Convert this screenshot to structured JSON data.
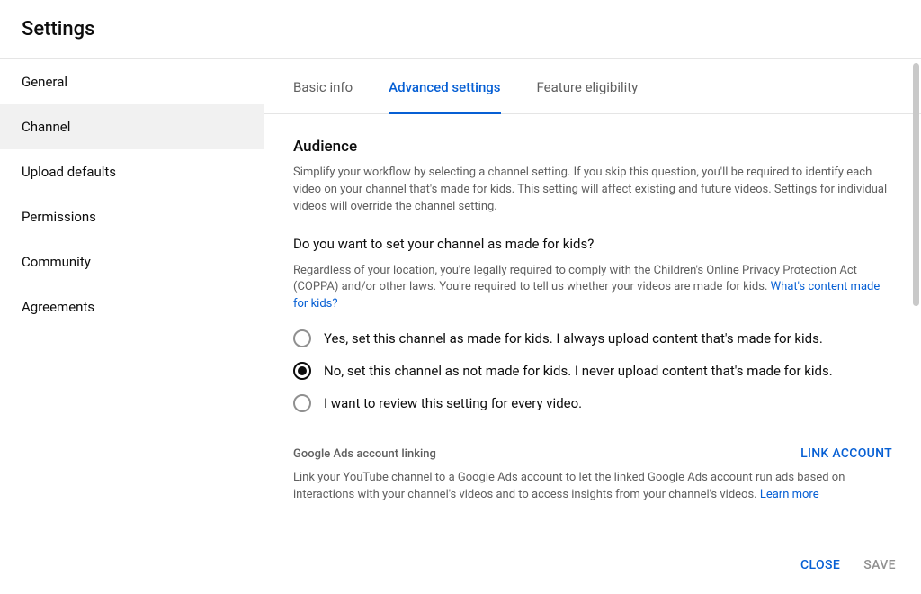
{
  "header": {
    "title": "Settings"
  },
  "sidebar": {
    "items": [
      {
        "label": "General"
      },
      {
        "label": "Channel",
        "active": true
      },
      {
        "label": "Upload defaults"
      },
      {
        "label": "Permissions"
      },
      {
        "label": "Community"
      },
      {
        "label": "Agreements"
      }
    ]
  },
  "tabs": [
    {
      "label": "Basic info"
    },
    {
      "label": "Advanced settings",
      "active": true
    },
    {
      "label": "Feature eligibility"
    }
  ],
  "audience": {
    "title": "Audience",
    "description": "Simplify your workflow by selecting a channel setting. If you skip this question, you'll be required to identify each video on your channel that's made for kids. This setting will affect existing and future videos. Settings for individual videos will override the channel setting.",
    "question": "Do you want to set your channel as made for kids?",
    "legal_text": "Regardless of your location, you're legally required to comply with the Children's Online Privacy Protection Act (COPPA) and/or other laws. You're required to tell us whether your videos are made for kids. ",
    "legal_link": "What's content made for kids?",
    "options": [
      {
        "label": "Yes, set this channel as made for kids. I always upload content that's made for kids."
      },
      {
        "label": "No, set this channel as not made for kids. I never upload content that's made for kids.",
        "selected": true
      },
      {
        "label": "I want to review this setting for every video."
      }
    ]
  },
  "ads_linking": {
    "title": "Google Ads account linking",
    "link_button": "LINK ACCOUNT",
    "description": "Link your YouTube channel to a Google Ads account to let the linked Google Ads account run ads based on interactions with your channel's videos and to access insights from your channel's videos. ",
    "learn_more": "Learn more"
  },
  "footer": {
    "close": "CLOSE",
    "save": "SAVE"
  }
}
